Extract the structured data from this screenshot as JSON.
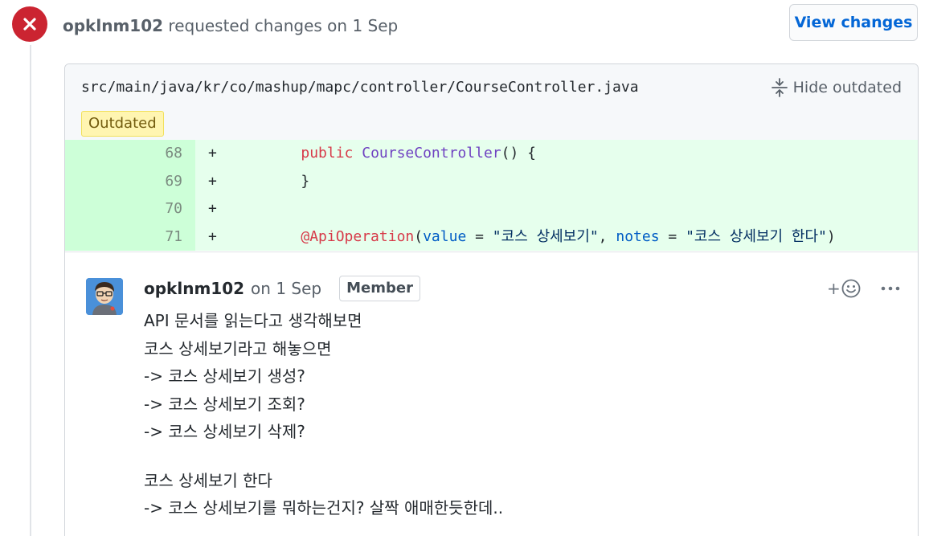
{
  "review": {
    "author": "opklnm102",
    "action": "requested changes on 1 Sep",
    "view_changes_label": "View changes",
    "status_color": "#cb2431"
  },
  "file": {
    "path": "src/main/java/kr/co/mashup/mapc/controller/CourseController.java",
    "hide_outdated_label": "Hide outdated",
    "outdated_badge": "Outdated"
  },
  "diff": {
    "lines": [
      {
        "num": "68",
        "sign": "+",
        "kw": "public",
        "fn": "CourseController",
        "rest": "() {"
      },
      {
        "num": "69",
        "sign": "+",
        "code": "}"
      },
      {
        "num": "70",
        "sign": "+",
        "code": ""
      },
      {
        "num": "71",
        "sign": "+",
        "annotation": "@ApiOperation",
        "open": "(",
        "p1": "value",
        "eq1": " = ",
        "s1": "\"코스 상세보기\"",
        "comma": ", ",
        "p2": "notes",
        "eq2": " = ",
        "s2": "\"코스 상세보기 한다\"",
        "close": ")"
      }
    ]
  },
  "comment": {
    "author": "opklnm102",
    "date": "on 1 Sep",
    "badge": "Member",
    "reaction_plus": "+",
    "body_lines": [
      "API 문서를 읽는다고 생각해보면",
      "코스 상세보기라고 해놓으면",
      "-> 코스 상세보기 생성?",
      "-> 코스 상세보기 조회?",
      "-> 코스 상세보기 삭제?",
      "코스 상세보기 한다",
      "-> 코스 상세보기를 뭐하는건지? 살짝 애매한듯한데.."
    ]
  },
  "icons": {
    "status": "x-circle-icon",
    "hide_outdated": "fold-icon",
    "reaction": "smiley-icon",
    "more": "kebab-horizontal-icon"
  }
}
